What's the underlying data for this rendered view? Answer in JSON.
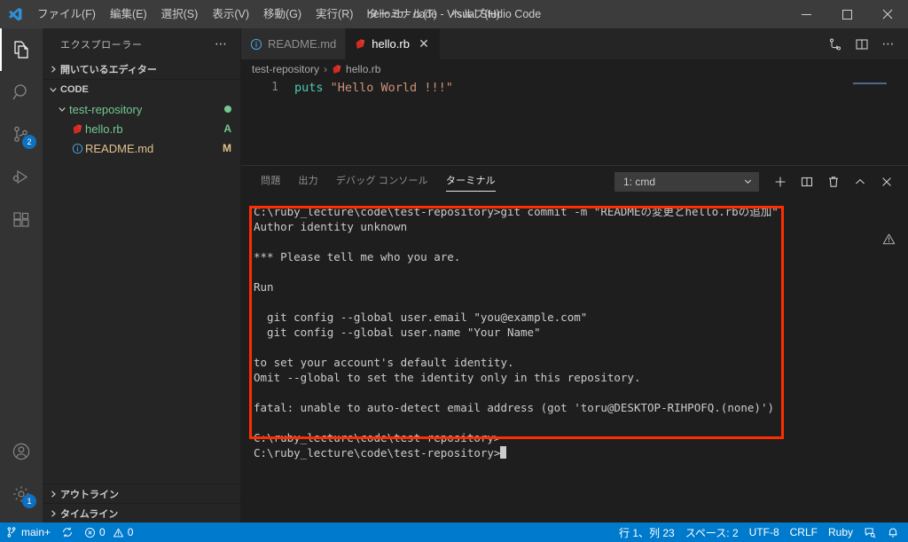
{
  "window": {
    "title": "hello.rb - code - Visual Studio Code",
    "minimize_label": "─",
    "maximize_label": "□",
    "close_label": "✕"
  },
  "menu": {
    "items": [
      {
        "label": "ファイル(F)",
        "name": "menu-file"
      },
      {
        "label": "編集(E)",
        "name": "menu-edit"
      },
      {
        "label": "選択(S)",
        "name": "menu-selection"
      },
      {
        "label": "表示(V)",
        "name": "menu-view"
      },
      {
        "label": "移動(G)",
        "name": "menu-go"
      },
      {
        "label": "実行(R)",
        "name": "menu-run"
      },
      {
        "label": "ターミナル(T)",
        "name": "menu-terminal"
      },
      {
        "label": "ヘルプ(H)",
        "name": "menu-help"
      }
    ]
  },
  "activitybar": {
    "items": [
      {
        "icon": "files-explorer-icon",
        "active": true,
        "badge": ""
      },
      {
        "icon": "search-icon",
        "active": false,
        "badge": ""
      },
      {
        "icon": "source-control-icon",
        "active": false,
        "badge": "2"
      },
      {
        "icon": "run-and-debug-icon",
        "active": false,
        "badge": ""
      },
      {
        "icon": "extensions-icon",
        "active": false,
        "badge": ""
      }
    ],
    "bottom": [
      {
        "icon": "account-icon",
        "badge": ""
      },
      {
        "icon": "settings-gear-icon",
        "badge": "1"
      }
    ]
  },
  "sidebar": {
    "title": "エクスプローラー",
    "more_label": "⋯",
    "open_editors_label": "開いているエディター",
    "folder_label": "CODE",
    "tree": [
      {
        "label": "test-repository",
        "indent": 20,
        "icon": "chevron-down-icon",
        "status": "",
        "dot": true
      },
      {
        "label": "hello.rb",
        "indent": 34,
        "icon": "ruby-file-icon",
        "status": "A",
        "status_color": "#73c991",
        "label_color": "#73c991"
      },
      {
        "label": "README.md",
        "indent": 34,
        "icon": "markdown-info-icon",
        "status": "M",
        "status_color": "#e2c08d",
        "label_color": "#e2c08d"
      }
    ],
    "outline_label": "アウトライン",
    "timeline_label": "タイムライン"
  },
  "editor": {
    "tabs": [
      {
        "label": "README.md",
        "icon": "markdown-info-icon",
        "active": false,
        "has_close": false
      },
      {
        "label": "hello.rb",
        "icon": "ruby-file-icon",
        "active": true,
        "has_close": true,
        "close_label": "✕"
      }
    ],
    "actions": [
      {
        "icon": "open-changes-icon"
      },
      {
        "icon": "split-editor-icon"
      },
      {
        "icon": "more-actions-icon",
        "label": "⋯"
      }
    ],
    "breadcrumb": {
      "folder": "test-repository",
      "separator": "›",
      "file": "hello.rb"
    },
    "code": {
      "line_number": "1",
      "keyword": "puts",
      "string": "\"Hello World !!!\""
    }
  },
  "panel": {
    "tabs": [
      {
        "label": "問題",
        "active": false
      },
      {
        "label": "出力",
        "active": false
      },
      {
        "label": "デバッグ コンソール",
        "active": false
      },
      {
        "label": "ターミナル",
        "active": true
      }
    ],
    "terminal_select": "1: cmd",
    "chevron": "⌄",
    "actions": [
      {
        "icon": "add-terminal-icon",
        "label": "＋"
      },
      {
        "icon": "split-terminal-icon"
      },
      {
        "icon": "kill-terminal-icon"
      },
      {
        "icon": "chevron-up-icon",
        "label": "∧"
      },
      {
        "icon": "close-panel-icon",
        "label": "✕"
      }
    ],
    "warning_icon": "warning-triangle-icon"
  },
  "terminal": {
    "lines": [
      "C:\\ruby_lecture\\code\\test-repository>git commit -m \"READMEの変更とhello.rbの追加\"",
      "Author identity unknown",
      "",
      "*** Please tell me who you are.",
      "",
      "Run",
      "",
      "  git config --global user.email \"you@example.com\"",
      "  git config --global user.name \"Your Name\"",
      "",
      "to set your account's default identity.",
      "Omit --global to set the identity only in this repository.",
      "",
      "fatal: unable to auto-detect email address (got 'toru@DESKTOP-RIHPOFQ.(none)')"
    ],
    "prompt_lines": [
      "C:\\ruby_lecture\\code\\test-repository>",
      "C:\\ruby_lecture\\code\\test-repository>"
    ],
    "highlight_color": "#ff2d00"
  },
  "statusbar": {
    "branch": "main+",
    "sync_icon": "sync-icon",
    "errors": "0",
    "warnings": "0",
    "position": "行 1、列 23",
    "indentation": "スペース: 2",
    "encoding": "UTF-8",
    "eol": "CRLF",
    "language": "Ruby",
    "feedback_icon": "feedback-icon",
    "bell_icon": "bell-icon",
    "background": "#007acc"
  }
}
